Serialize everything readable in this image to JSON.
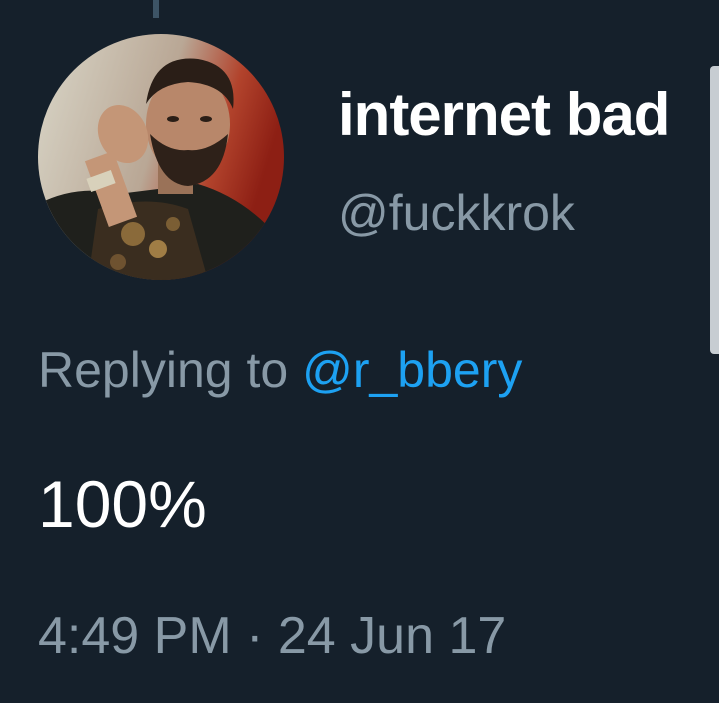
{
  "tweet": {
    "display_name": "internet bad",
    "handle": "@fuckkrok",
    "replying_prefix": "Replying to",
    "replying_to": "@r_bbery",
    "text": "100%",
    "time": "4:49 PM",
    "separator": "·",
    "date": "24 Jun 17"
  },
  "colors": {
    "background": "#15202b",
    "primary_text": "#ffffff",
    "secondary_text": "#8899a6",
    "link": "#1da1f2"
  },
  "icons": {
    "avatar": "profile-photo"
  }
}
